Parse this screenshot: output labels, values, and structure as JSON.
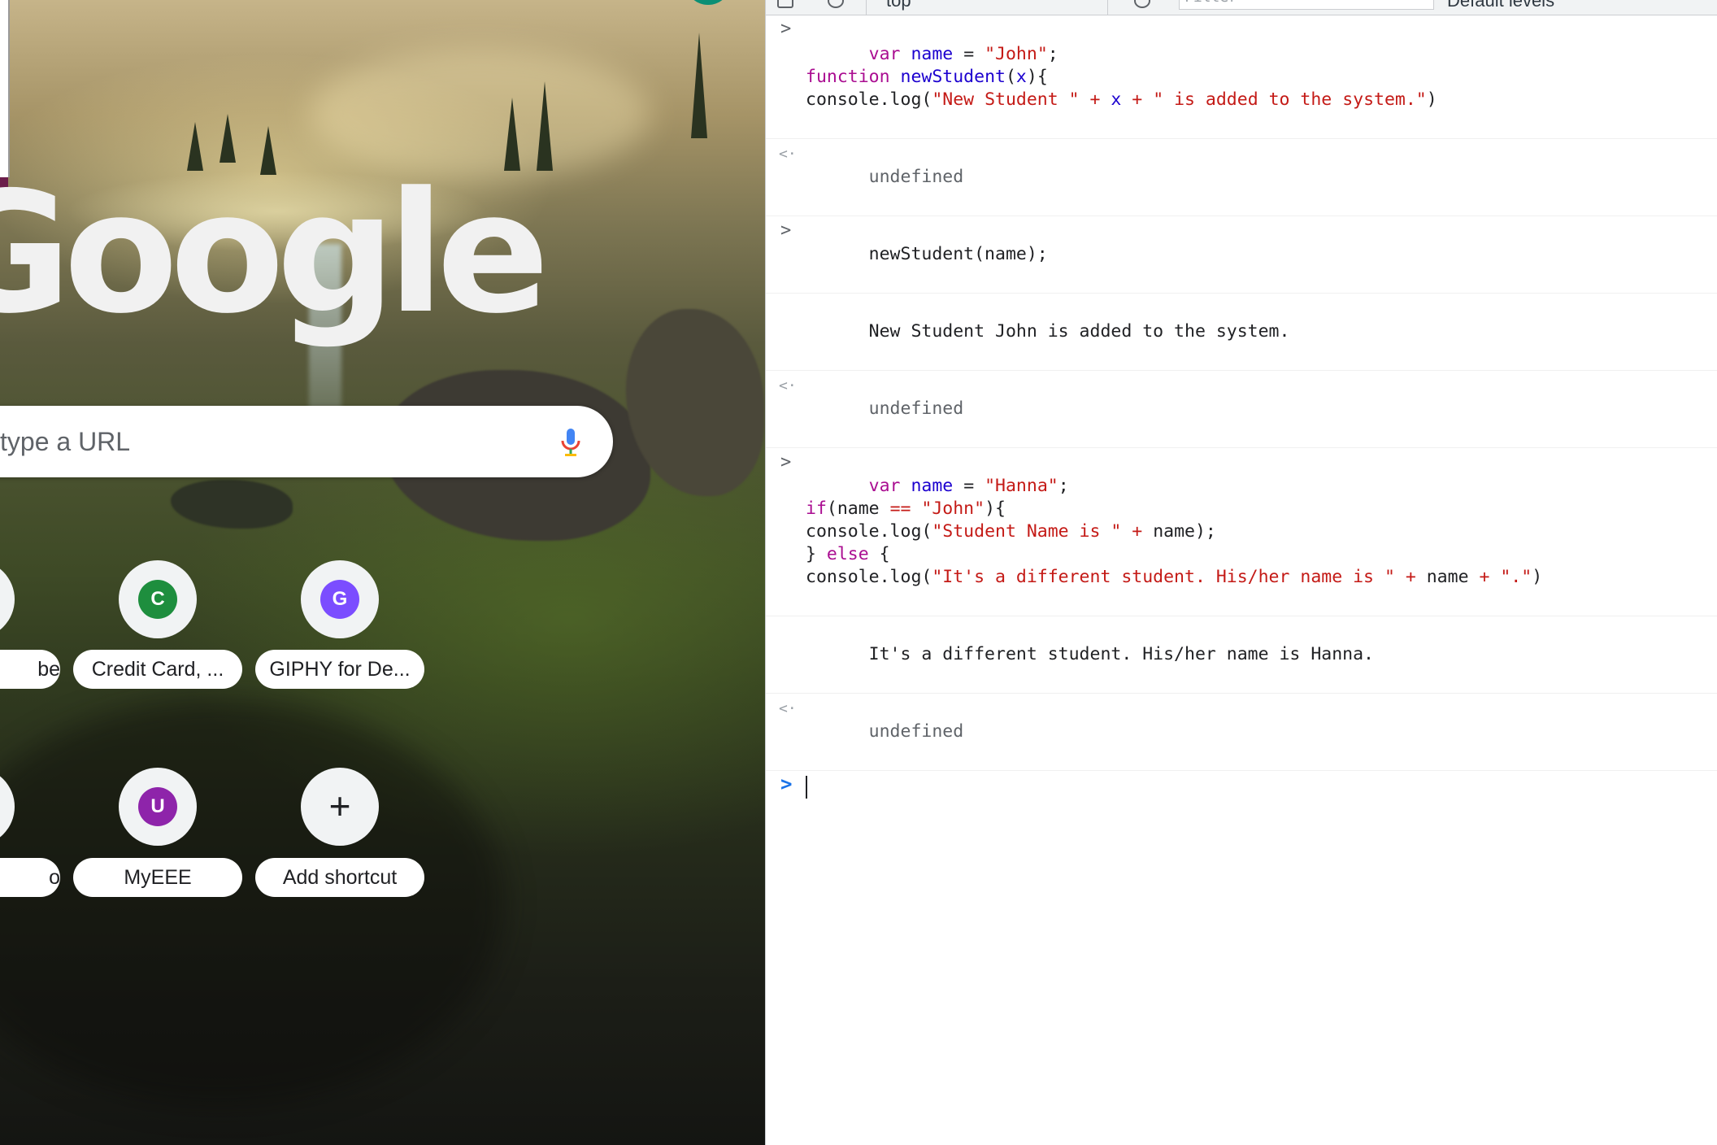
{
  "ntp": {
    "logo": "Google",
    "search_placeholder": "type a URL",
    "shortcuts_row1": [
      {
        "label": "be",
        "letter": ""
      },
      {
        "label": "Credit Card, ...",
        "letter": "C",
        "color": "#1e8e3e"
      },
      {
        "label": "GIPHY for De...",
        "letter": "G",
        "color": "#7b4dff"
      }
    ],
    "shortcuts_row2": [
      {
        "label": "o",
        "letter": ""
      },
      {
        "label": "MyEEE",
        "letter": "U",
        "color": "#8e24aa"
      },
      {
        "label": "Add shortcut",
        "icon": "+"
      }
    ]
  },
  "devtools": {
    "toolbar": {
      "context": "top",
      "filter_placeholder": "Filter",
      "levels": "Default levels"
    },
    "console": {
      "entry1": {
        "l1_kw": "var",
        "l1_var": "name",
        "l1_op": " = ",
        "l1_str": "\"John\"",
        "l1_end": ";",
        "l2_kw": "function",
        "l2_fn": "newStudent",
        "l2_a": "(",
        "l2_param": "x",
        "l2_b": "){",
        "l3_a": "console.log(",
        "l3_s1": "\"New Student \"",
        "l3_p1": " + ",
        "l3_x": "x",
        "l3_p2": " + ",
        "l3_s2": "\" is added to the system.\"",
        "l3_end": ")"
      },
      "result1": "undefined",
      "entry2": "newStudent(name);",
      "log2": "New Student John is added to the system.",
      "result2": "undefined",
      "entry3": {
        "l1_kw": "var",
        "l1_var": "name",
        "l1_op": " = ",
        "l1_str": "\"Hanna\"",
        "l1_end": ";",
        "l2_kw": "if",
        "l2_a": "(name ",
        "l2_op": "==",
        "l2_sp": " ",
        "l2_str": "\"John\"",
        "l2_end": "){",
        "l3_a": "console.log(",
        "l3_str": "\"Student Name is \"",
        "l3_op": " + ",
        "l3_end": "name);",
        "l4_a": "} ",
        "l4_kw": "else",
        "l4_end": " {",
        "l5_a": "console.log(",
        "l5_s1": "\"It's a different student. His/her name is \"",
        "l5_p1": " + ",
        "l5_name": "name",
        "l5_p2": " + ",
        "l5_s2": "\".\"",
        "l5_end": ")"
      },
      "log3": "It's a different student. His/her name is Hanna.",
      "result3": "undefined"
    }
  }
}
